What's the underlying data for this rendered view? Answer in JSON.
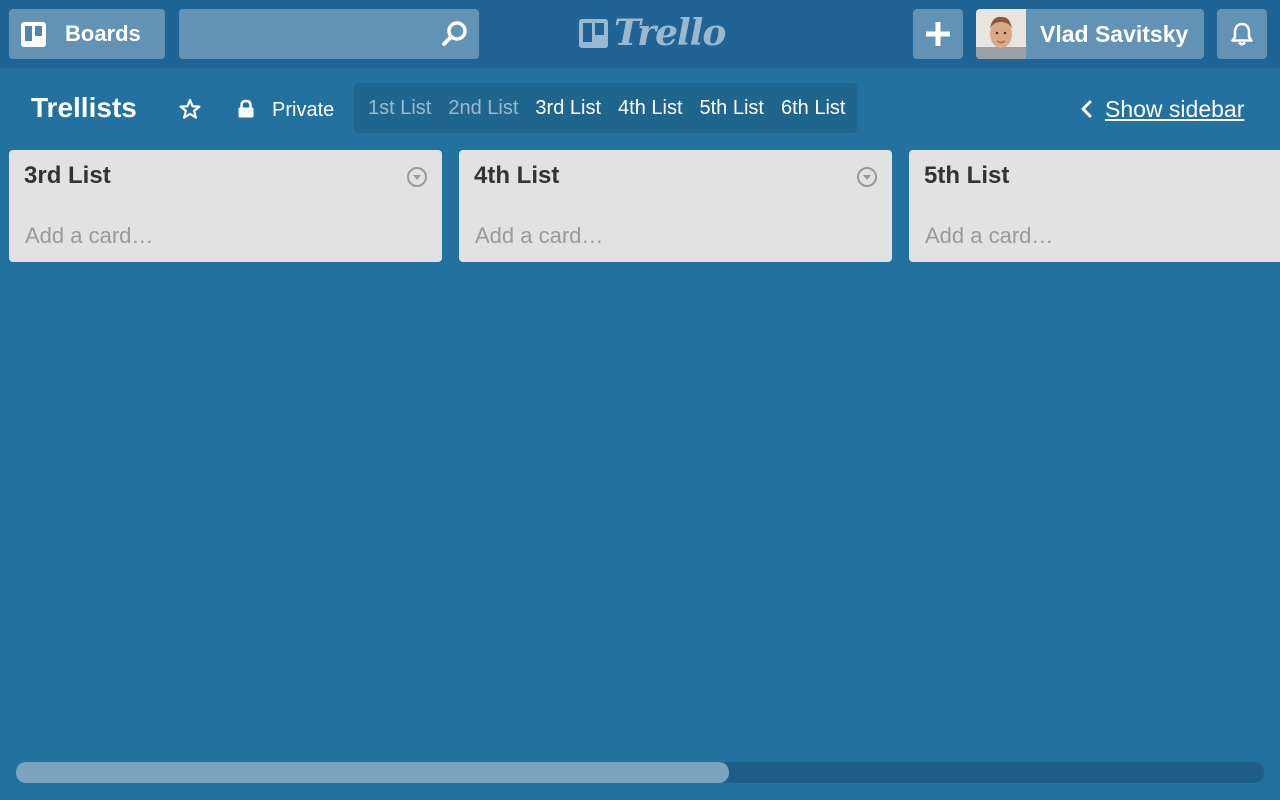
{
  "header": {
    "boards_label": "Boards",
    "search_placeholder": "",
    "logo_text": "Trello",
    "user_name": "Vlad Savitsky"
  },
  "board": {
    "title": "Trellists",
    "privacy": "Private",
    "list_nav": [
      {
        "label": "1st List",
        "dimmed": true
      },
      {
        "label": "2nd List",
        "dimmed": true
      },
      {
        "label": "3rd List",
        "dimmed": false
      },
      {
        "label": "4th List",
        "dimmed": false
      },
      {
        "label": "5th List",
        "dimmed": false
      },
      {
        "label": "6th List",
        "dimmed": false
      }
    ],
    "sidebar_toggle": "Show sidebar"
  },
  "lists": [
    {
      "title": "3rd List",
      "add_card": "Add a card…"
    },
    {
      "title": "4th List",
      "add_card": "Add a card…"
    },
    {
      "title": "5th List",
      "add_card": "Add a card…"
    }
  ],
  "colors": {
    "board_bg": "#23719f",
    "header_bg": "#1f6494",
    "list_bg": "#e2e2e2"
  },
  "icons": [
    "boards-icon",
    "search-icon",
    "trello-logo-icon",
    "plus-icon",
    "bell-icon",
    "star-icon",
    "lock-icon",
    "chevron-left-icon",
    "list-menu-icon"
  ]
}
